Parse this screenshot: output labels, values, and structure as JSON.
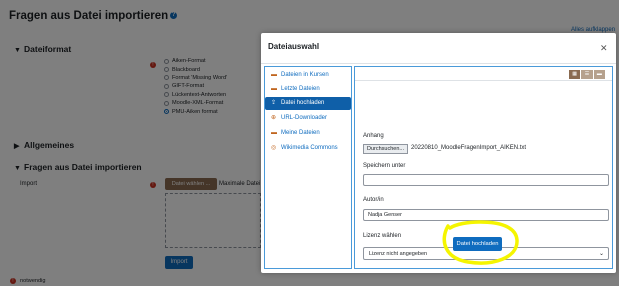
{
  "page": {
    "title": "Fragen aus Datei importieren",
    "expand_all": "Alles aufklappen",
    "sections": {
      "file_format": "Dateiformat",
      "general": "Allgemeines",
      "import_section": "Fragen aus Datei importieren"
    },
    "formats": [
      {
        "label": "Aiken-Format",
        "checked": false
      },
      {
        "label": "Blackboard",
        "checked": false
      },
      {
        "label": "Format 'Missing Word'",
        "checked": false
      },
      {
        "label": "GIFT-Format",
        "checked": false
      },
      {
        "label": "Lückentext-Antworten",
        "checked": false
      },
      {
        "label": "Moodle-XML-Format",
        "checked": false
      },
      {
        "label": "PMU-Aiken format",
        "checked": true
      }
    ],
    "import_label": "Import",
    "choose_file_button": "Datei wählen ...",
    "max_size_text": "Maximale Datei",
    "import_button": "Import",
    "required_note": "notwendig"
  },
  "modal": {
    "title": "Dateiauswahl",
    "repositories": [
      {
        "label": "Dateien in Kursen",
        "icon": "folder-icon",
        "active": false
      },
      {
        "label": "Letzte Dateien",
        "icon": "recent-files-icon",
        "active": false
      },
      {
        "label": "Datei hochladen",
        "icon": "upload-icon",
        "active": true
      },
      {
        "label": "URL-Downloader",
        "icon": "url-icon",
        "active": false
      },
      {
        "label": "Meine Dateien",
        "icon": "folder-icon",
        "active": false
      },
      {
        "label": "Wikimedia Commons",
        "icon": "wikimedia-icon",
        "active": false
      }
    ],
    "attachment_label": "Anhang",
    "browse_button": "Durchsuchen...",
    "selected_file": "20220810_MoodleFragenImport_AIKEN.txt",
    "save_as_label": "Speichern unter",
    "save_as_value": "",
    "author_label": "Autor/in",
    "author_value": "Nadja Genser",
    "license_label": "Lizenz wählen",
    "license_value": "Lizenz nicht angegeben",
    "upload_button": "Datei hochladen"
  },
  "colors": {
    "primary": "#0f6cbf",
    "secondary": "#8a6a50",
    "highlight": "#f5f500",
    "required": "#ca3120"
  }
}
